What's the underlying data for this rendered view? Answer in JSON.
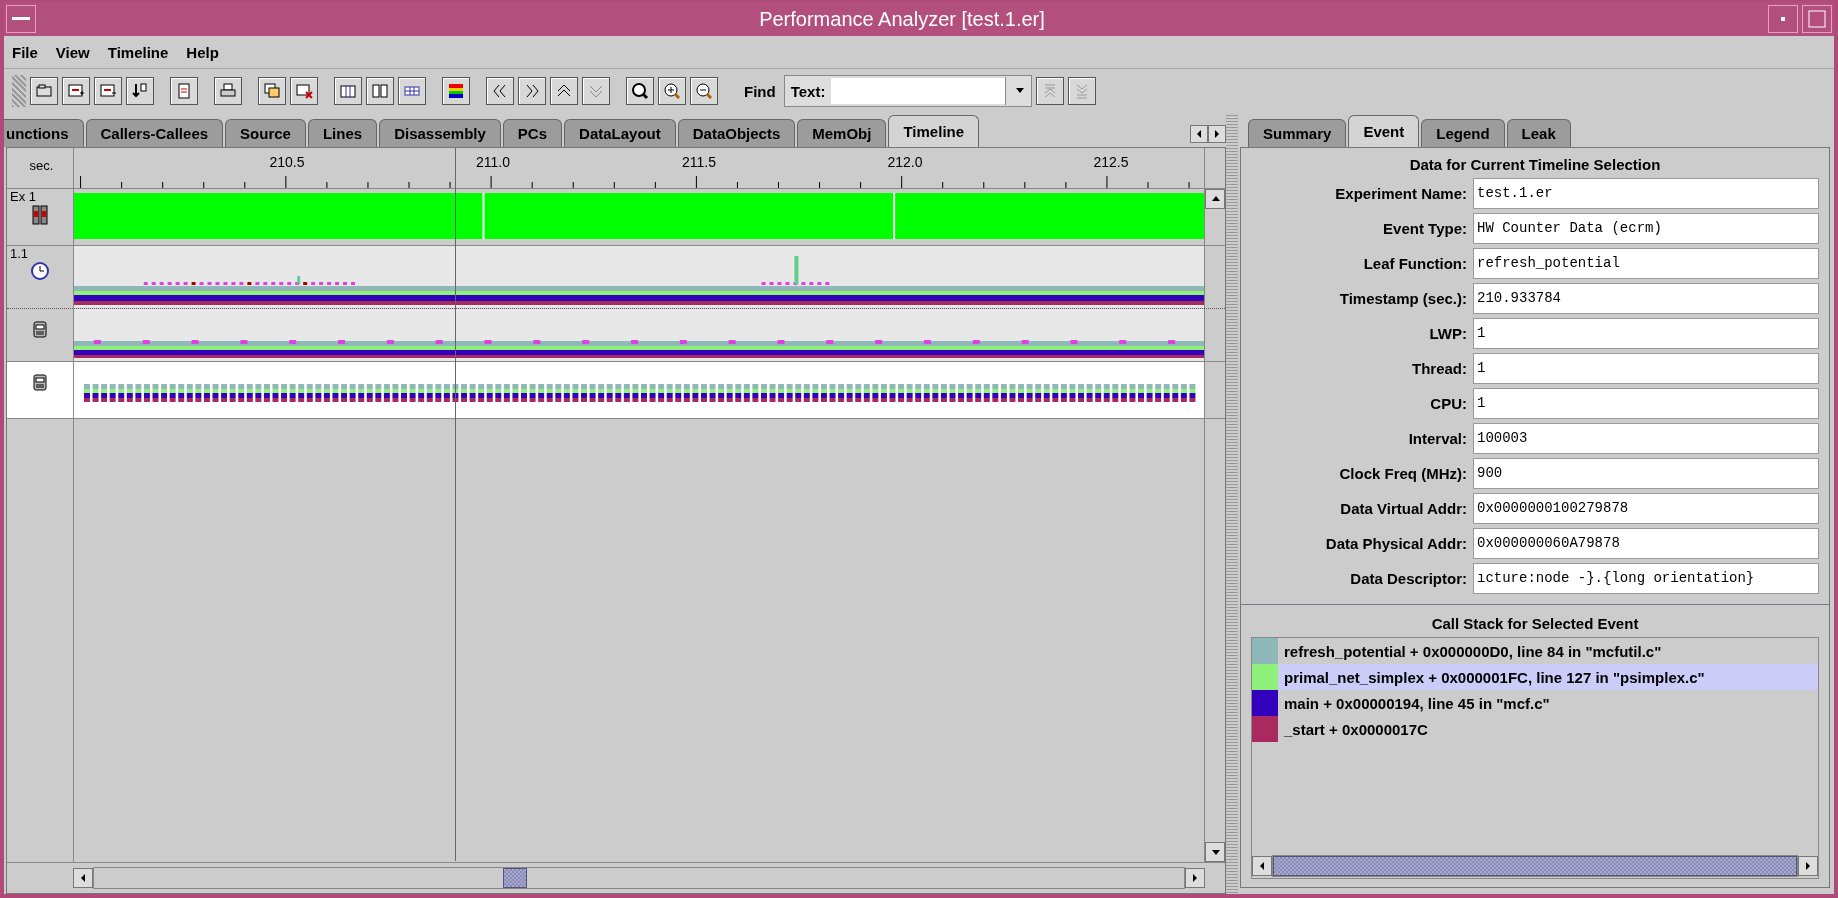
{
  "window": {
    "title": "Performance Analyzer [test.1.er]"
  },
  "menu": [
    "File",
    "View",
    "Timeline",
    "Help"
  ],
  "toolbar": {
    "find_label": "Find",
    "text_label": "Text:"
  },
  "left_tabs": [
    {
      "label": "unctions",
      "selected": false
    },
    {
      "label": "Callers-Callees",
      "selected": false
    },
    {
      "label": "Source",
      "selected": false
    },
    {
      "label": "Lines",
      "selected": false
    },
    {
      "label": "Disassembly",
      "selected": false
    },
    {
      "label": "PCs",
      "selected": false
    },
    {
      "label": "DataLayout",
      "selected": false
    },
    {
      "label": "DataObjects",
      "selected": false
    },
    {
      "label": "MemObj",
      "selected": false
    },
    {
      "label": "Timeline",
      "selected": true
    }
  ],
  "timeline": {
    "unit_label": "sec.",
    "ticks": [
      "210.5",
      "211.0",
      "211.5",
      "212.0",
      "212.5"
    ],
    "rows": [
      {
        "label": "Ex 1",
        "kind": "experiment"
      },
      {
        "label": "1.1",
        "kind": "clock"
      },
      {
        "kind": "counter"
      },
      {
        "kind": "counter-white"
      }
    ]
  },
  "right_tabs": [
    {
      "label": "Summary",
      "selected": false
    },
    {
      "label": "Event",
      "selected": true
    },
    {
      "label": "Legend",
      "selected": false
    },
    {
      "label": "Leak",
      "selected": false
    }
  ],
  "event_panel": {
    "title": "Data for Current Timeline Selection",
    "fields": [
      {
        "label": "Experiment Name:",
        "value": "test.1.er"
      },
      {
        "label": "Event Type:",
        "value": "HW Counter Data (ecrm)"
      },
      {
        "label": "Leaf Function:",
        "value": "refresh_potential"
      },
      {
        "label": "Timestamp (sec.):",
        "value": "210.933784"
      },
      {
        "label": "LWP:",
        "value": "1"
      },
      {
        "label": "Thread:",
        "value": "1"
      },
      {
        "label": "CPU:",
        "value": "1"
      },
      {
        "label": "Interval:",
        "value": "100003"
      },
      {
        "label": "Clock Freq (MHz):",
        "value": "900"
      },
      {
        "label": "Data Virtual Addr:",
        "value": "0x0000000100279878"
      },
      {
        "label": "Data Physical Addr:",
        "value": "0x000000060A79878"
      },
      {
        "label": "Data Descriptor:",
        "value": "ıcture:node -}.{long orientation}"
      }
    ]
  },
  "call_stack": {
    "title": "Call Stack for Selected Event",
    "frames": [
      {
        "text": "refresh_potential + 0x000000D0,  line 84 in \"mcfutil.c\"",
        "color": "#8fb8b8",
        "selected": false
      },
      {
        "text": "primal_net_simplex + 0x000001FC,  line 127 in \"psimplex.c\"",
        "color": "#8ff07a",
        "selected": true
      },
      {
        "text": "main + 0x00000194,  line 45 in \"mcf.c\"",
        "color": "#3300bb",
        "selected": false
      },
      {
        "text": "_start + 0x0000017C",
        "color": "#a82a5e",
        "selected": false
      }
    ]
  }
}
